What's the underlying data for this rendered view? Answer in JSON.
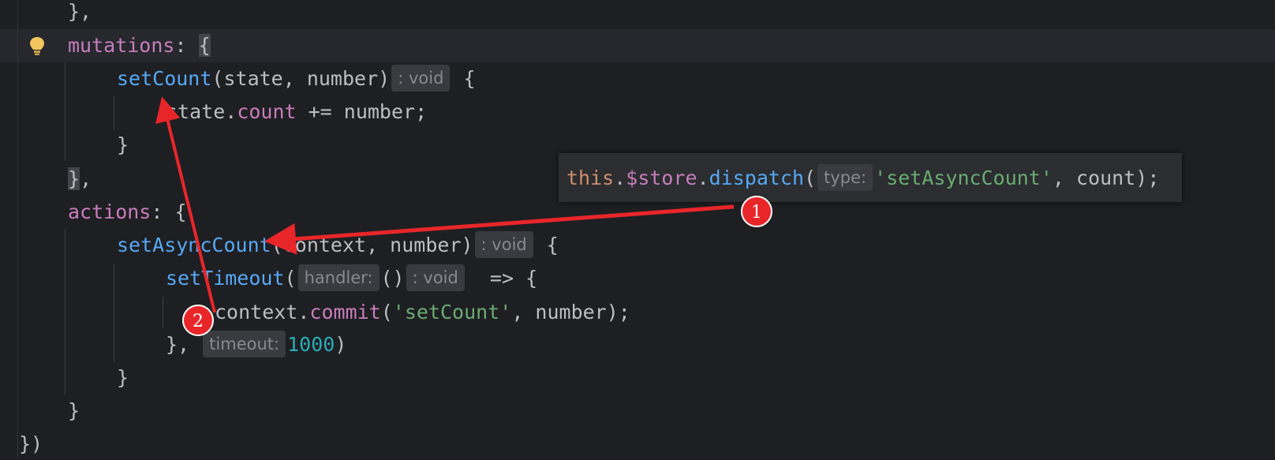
{
  "editor": {
    "lines": {
      "l1": "},",
      "l2_key": "mutations",
      "l2_rest": ": ",
      "l2_brace": "{",
      "l3_fn": "setCount",
      "l3_params": "(state, number)",
      "l3_hint": ": void",
      "l3_brace": " {",
      "l4_a": "state.",
      "l4_prop": "count",
      "l4_b": " += number;",
      "l5": "}",
      "l6_brace": "}",
      "l6_rest": ",",
      "l7_key": "actions",
      "l7_rest": ": {",
      "l8_fn": "setAsyncCount",
      "l8_params": "(context, number)",
      "l8_hint": ": void",
      "l8_brace": " {",
      "l9_fn": "setTimeout",
      "l9_paren": "(",
      "l9_hint1": "handler:",
      "l9_parens": "()",
      "l9_hint2": ": void",
      "l9_arrow": "  => {",
      "l10_a": "context.",
      "l10_fn": "commit",
      "l10_b": "(",
      "l10_str": "'setCount'",
      "l10_c": ", number);",
      "l11_a": "},",
      "l11_hint": "timeout:",
      "l11_num": "1000",
      "l11_b": ")",
      "l12": "}",
      "l13": "}",
      "l14": "})"
    }
  },
  "popup": {
    "this": "this",
    "dot1": ".",
    "store": "$store",
    "dot2": ".",
    "fn": "dispatch",
    "paren": "(",
    "hint": "type:",
    "str": "'setAsyncCount'",
    "rest": ", count);"
  },
  "annotations": {
    "badge1": "1",
    "badge2": "2",
    "color": "#e8262a"
  },
  "icons": {
    "bulb": "lightbulb-icon"
  }
}
